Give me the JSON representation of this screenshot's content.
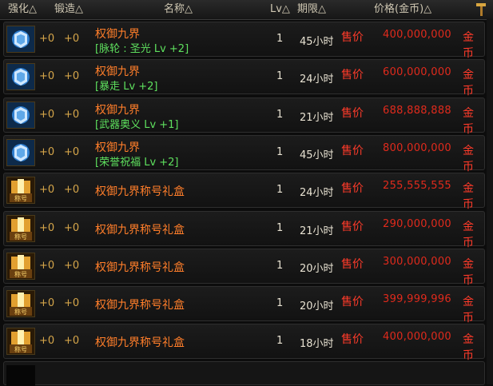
{
  "header": {
    "enhance": "强化△",
    "forge": "锻造△",
    "name": "名称△",
    "lv": "Lv△",
    "duration": "期限△",
    "price": "价格(金币)△"
  },
  "rows": [
    {
      "icon": "armor-icon",
      "enh": "+0",
      "forge": "+0",
      "name": "权御九界",
      "sub": "[脉轮 : 圣光 Lv +2]",
      "lv": "1",
      "dur": "45小时",
      "sell": "售价",
      "price": "400,000,000",
      "cur": "金币"
    },
    {
      "icon": "armor-icon",
      "enh": "+0",
      "forge": "+0",
      "name": "权御九界",
      "sub": "[暴走 Lv +2]",
      "lv": "1",
      "dur": "24小时",
      "sell": "售价",
      "price": "600,000,000",
      "cur": "金币"
    },
    {
      "icon": "armor-icon",
      "enh": "+0",
      "forge": "+0",
      "name": "权御九界",
      "sub": "[武器奥义 Lv +1]",
      "lv": "1",
      "dur": "21小时",
      "sell": "售价",
      "price": "688,888,888",
      "cur": "金币"
    },
    {
      "icon": "armor-icon",
      "enh": "+0",
      "forge": "+0",
      "name": "权御九界",
      "sub": "[荣誉祝福 Lv +2]",
      "lv": "1",
      "dur": "45小时",
      "sell": "售价",
      "price": "800,000,000",
      "cur": "金币"
    },
    {
      "icon": "title-box-icon",
      "enh": "+0",
      "forge": "+0",
      "name": "权御九界称号礼盒",
      "lv": "1",
      "dur": "24小时",
      "sell": "售价",
      "price": "255,555,555",
      "cur": "金币"
    },
    {
      "icon": "title-box-icon",
      "enh": "+0",
      "forge": "+0",
      "name": "权御九界称号礼盒",
      "lv": "1",
      "dur": "21小时",
      "sell": "售价",
      "price": "290,000,000",
      "cur": "金币"
    },
    {
      "icon": "title-box-icon",
      "enh": "+0",
      "forge": "+0",
      "name": "权御九界称号礼盒",
      "lv": "1",
      "dur": "20小时",
      "sell": "售价",
      "price": "300,000,000",
      "cur": "金币"
    },
    {
      "icon": "title-box-icon",
      "enh": "+0",
      "forge": "+0",
      "name": "权御九界称号礼盒",
      "lv": "1",
      "dur": "20小时",
      "sell": "售价",
      "price": "399,999,996",
      "cur": "金币"
    },
    {
      "icon": "title-box-icon",
      "enh": "+0",
      "forge": "+0",
      "name": "权御九界称号礼盒",
      "lv": "1",
      "dur": "18小时",
      "sell": "售价",
      "price": "400,000,000",
      "cur": "金币"
    }
  ],
  "badge_text": "称号",
  "colors": {
    "name": "#ff7e2a",
    "option": "#5ee05e",
    "price": "#e02a1c",
    "gold": "#d6a64a"
  }
}
